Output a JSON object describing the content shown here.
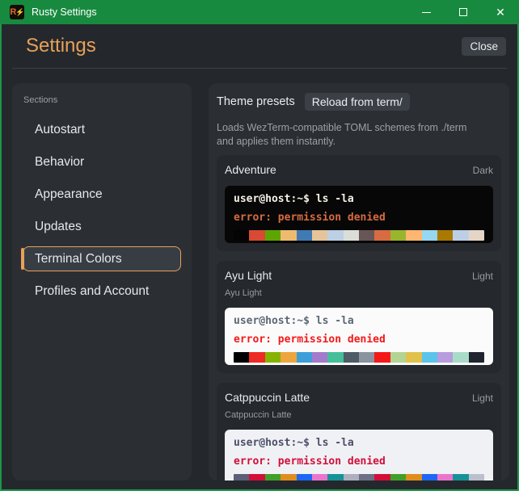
{
  "colors": {
    "titlebar_green": "#188a40",
    "window_border_green": "#1e9549",
    "accent_orange": "#e9a05a",
    "panel_bg": "#2b2f34",
    "card_bg": "#25282d"
  },
  "window": {
    "title": "Rusty Settings",
    "icon_letter": "R",
    "icon_bolt": "⚡",
    "close_glyph": "✕"
  },
  "header": {
    "title": "Settings",
    "close_label": "Close"
  },
  "sidebar": {
    "label": "Sections",
    "items": [
      {
        "label": "Autostart",
        "selected": false
      },
      {
        "label": "Behavior",
        "selected": false
      },
      {
        "label": "Appearance",
        "selected": false
      },
      {
        "label": "Updates",
        "selected": false
      },
      {
        "label": "Terminal Colors",
        "selected": true
      },
      {
        "label": "Profiles and Account",
        "selected": false
      }
    ]
  },
  "main": {
    "heading": "Theme presets",
    "reload_button": "Reload from term/",
    "description": "Loads WezTerm-compatible TOML schemes from ./term and applies them instantly.",
    "preview": {
      "prompt": "user@host:~$ ls -la",
      "error": "error: permission denied"
    },
    "themes": [
      {
        "name": "Adventure",
        "variant": "Dark",
        "subtitle": null,
        "terminal": {
          "bg": "#070707",
          "fg": "#f4f1e6",
          "error": "#d76b42"
        },
        "palette": [
          "#040404",
          "#d84a33",
          "#5da602",
          "#eebb6e",
          "#417ab3",
          "#e5c499",
          "#bdcfe5",
          "#dbded8",
          "#685656",
          "#d76b42",
          "#99b52c",
          "#ffb670",
          "#97d7ef",
          "#aa7900",
          "#bdcfe5",
          "#e4d5c7"
        ]
      },
      {
        "name": "Ayu Light",
        "variant": "Light",
        "subtitle": "Ayu Light",
        "terminal": {
          "bg": "#fbfbfb",
          "fg": "#5c6773",
          "error": "#f51818"
        },
        "palette": [
          "#000000",
          "#ee2a24",
          "#86b300",
          "#eda63e",
          "#3d9fda",
          "#a37acc",
          "#45bf99",
          "#4f5b66",
          "#8a939e",
          "#f51818",
          "#b3d492",
          "#e0c24a",
          "#5ac4ea",
          "#b79ddd",
          "#a8dcc8",
          "#20242e"
        ]
      },
      {
        "name": "Catppuccin Latte",
        "variant": "Light",
        "subtitle": "Catppuccin Latte",
        "terminal": {
          "bg": "#eff1f5",
          "fg": "#4c4f69",
          "error": "#d20f39"
        },
        "palette": [
          "#5c5f77",
          "#d20f39",
          "#40a02b",
          "#df8e1d",
          "#1e66f5",
          "#ea76cb",
          "#179299",
          "#acb0be",
          "#6c6f85",
          "#d20f39",
          "#40a02b",
          "#df8e1d",
          "#1e66f5",
          "#ea76cb",
          "#179299",
          "#bcc0cc"
        ]
      }
    ]
  }
}
